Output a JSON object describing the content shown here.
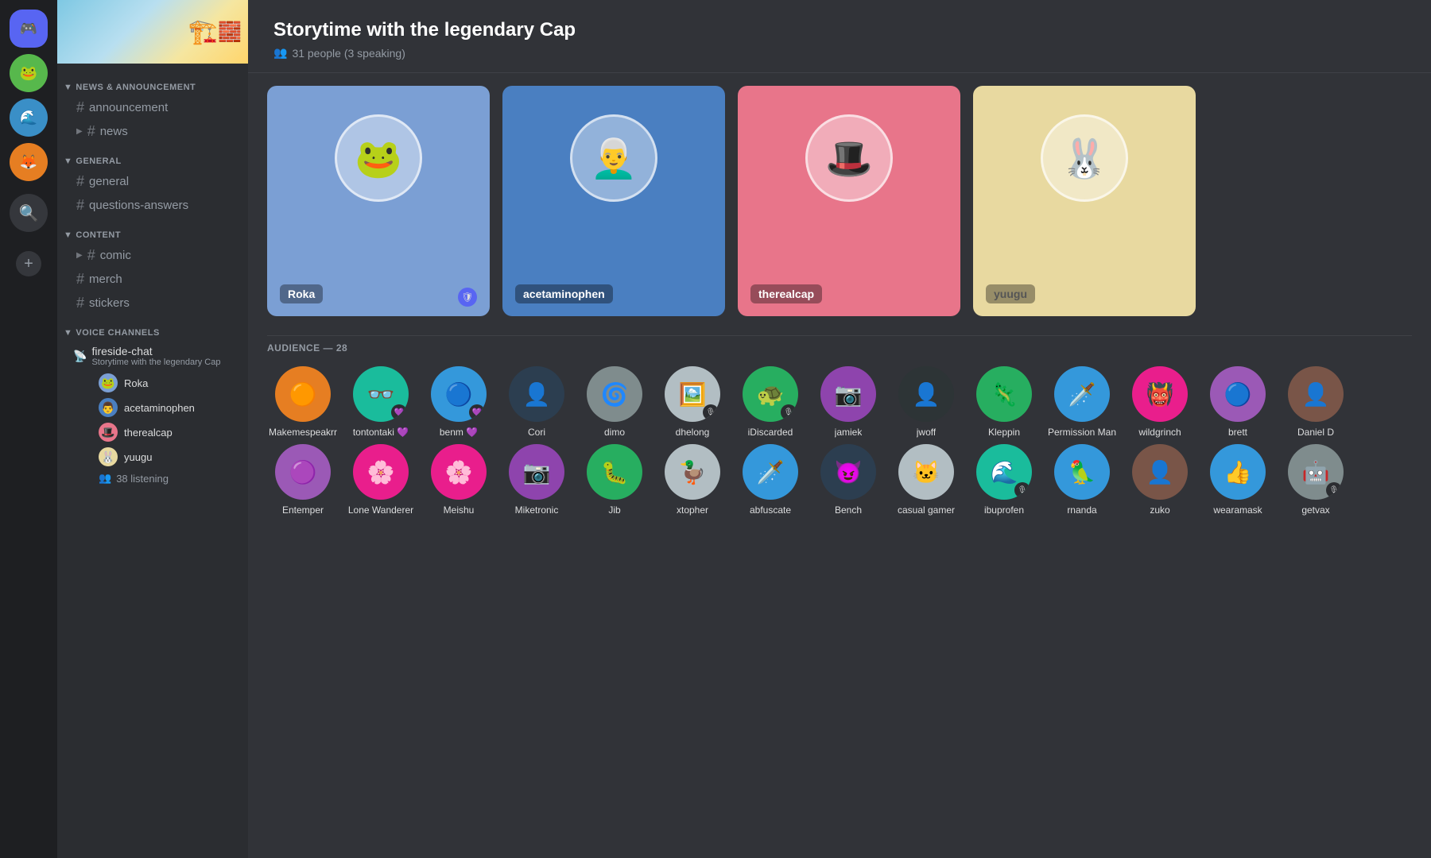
{
  "serverBar": {
    "icons": [
      {
        "id": "server-1",
        "emoji": "🎮",
        "color": "#5865f2"
      },
      {
        "id": "server-2",
        "emoji": "🐸",
        "color": "#57b84c"
      },
      {
        "id": "server-3",
        "emoji": "🌊",
        "color": "#3a8fc7"
      },
      {
        "id": "server-4",
        "emoji": "🦊",
        "color": "#e67e22"
      },
      {
        "id": "server-5",
        "emoji": "🔍",
        "color": "#35373c"
      }
    ]
  },
  "sidebar": {
    "categories": {
      "newsAnnouncement": "NEWS & ANNOUNCEMENT",
      "general": "GENERAL",
      "content": "CONTENT",
      "voiceChannels": "VOICE CHANNELS"
    },
    "channels": {
      "announcement": "announcement",
      "news": "news",
      "general": "general",
      "questionsAnswers": "questions-answers",
      "comic": "comic",
      "merch": "merch",
      "stickers": "stickers"
    },
    "voiceChannel": {
      "name": "fireside-chat",
      "subtitle": "Storytime with the legendary Cap"
    },
    "voiceMembers": [
      {
        "name": "Roka",
        "emoji": "🐸"
      },
      {
        "name": "acetaminophen",
        "emoji": "👨"
      },
      {
        "name": "therealcap",
        "emoji": "🎩"
      },
      {
        "name": "yuugu",
        "emoji": "🐰"
      }
    ],
    "listeningCount": "38 listening"
  },
  "stage": {
    "title": "Storytime with the legendary Cap",
    "meta": "31 people (3 speaking)",
    "audienceLabel": "AUDIENCE — 28"
  },
  "speakers": [
    {
      "name": "Roka",
      "color": "blue",
      "emoji": "🐸",
      "hasMod": true
    },
    {
      "name": "acetaminophen",
      "color": "bright-blue",
      "emoji": "👨‍🦳"
    },
    {
      "name": "therealcap",
      "color": "pink",
      "emoji": "🎩"
    },
    {
      "name": "yuugu",
      "color": "cream",
      "emoji": "🐰"
    }
  ],
  "audience": [
    {
      "name": "Makemespeakrr",
      "emoji": "🟠",
      "colorClass": "av-orange",
      "badge": null
    },
    {
      "name": "tontontaki",
      "emoji": "👓",
      "colorClass": "av-teal",
      "badge": "💜"
    },
    {
      "name": "benm",
      "emoji": "🔵",
      "colorClass": "av-blue",
      "badge": "💜"
    },
    {
      "name": "Cori",
      "emoji": "👤",
      "colorClass": "av-navy",
      "badge": null
    },
    {
      "name": "dimo",
      "emoji": "🌀",
      "colorClass": "av-gray",
      "badge": null
    },
    {
      "name": "dhelong",
      "emoji": "🖼️",
      "colorClass": "av-light",
      "badge": "🎙️"
    },
    {
      "name": "iDiscarded",
      "emoji": "🐢",
      "colorClass": "av-green",
      "badge": "🎙️"
    },
    {
      "name": "jamiek",
      "emoji": "📷",
      "colorClass": "av-photo",
      "badge": null
    },
    {
      "name": "jwoff",
      "emoji": "👤",
      "colorClass": "av-dark",
      "badge": null
    },
    {
      "name": "Kleppin",
      "emoji": "🦎",
      "colorClass": "av-green",
      "badge": null
    },
    {
      "name": "Permission Man",
      "emoji": "🗡️",
      "colorClass": "av-blue",
      "badge": null
    },
    {
      "name": "wildgrinch",
      "emoji": "👹",
      "colorClass": "av-pink",
      "badge": null
    },
    {
      "name": "brett",
      "emoji": "🔵",
      "colorClass": "av-purple",
      "badge": null
    },
    {
      "name": "Daniel D",
      "emoji": "👤",
      "colorClass": "av-brown",
      "badge": null
    },
    {
      "name": "Entemper",
      "emoji": "🟣",
      "colorClass": "av-purple",
      "badge": null
    },
    {
      "name": "Lone Wanderer",
      "emoji": "🌸",
      "colorClass": "av-pink",
      "badge": null
    },
    {
      "name": "Meishu",
      "emoji": "🌸",
      "colorClass": "av-pink",
      "badge": null
    },
    {
      "name": "Miketronic",
      "emoji": "📷",
      "colorClass": "av-photo",
      "badge": null
    },
    {
      "name": "Jib",
      "emoji": "🐛",
      "colorClass": "av-green",
      "badge": null
    },
    {
      "name": "xtopher",
      "emoji": "🦆",
      "colorClass": "av-light",
      "badge": null
    },
    {
      "name": "abfuscate",
      "emoji": "🗡️",
      "colorClass": "av-blue",
      "badge": null
    },
    {
      "name": "Bench",
      "emoji": "😈",
      "colorClass": "av-navy",
      "badge": null
    },
    {
      "name": "casual gamer",
      "emoji": "🐱",
      "colorClass": "av-light",
      "badge": null
    },
    {
      "name": "ibuprofen",
      "emoji": "🌊",
      "colorClass": "av-teal",
      "badge": "🎙️"
    },
    {
      "name": "rnanda",
      "emoji": "🦜",
      "colorClass": "av-blue",
      "badge": null
    },
    {
      "name": "zuko",
      "emoji": "👤",
      "colorClass": "av-brown",
      "badge": null
    },
    {
      "name": "wearamask",
      "emoji": "👍",
      "colorClass": "av-blue",
      "badge": null
    },
    {
      "name": "getvax",
      "emoji": "🤖",
      "colorClass": "av-gray",
      "badge": "🎙️"
    }
  ],
  "icons": {
    "hash": "#",
    "people": "👥",
    "mic": "🎙️",
    "plus": "+",
    "search": "🔍",
    "chevron_right": "▶",
    "chevron_down": "▼",
    "shield": "🛡️",
    "speaker": "🔊",
    "mod": "🛡"
  }
}
